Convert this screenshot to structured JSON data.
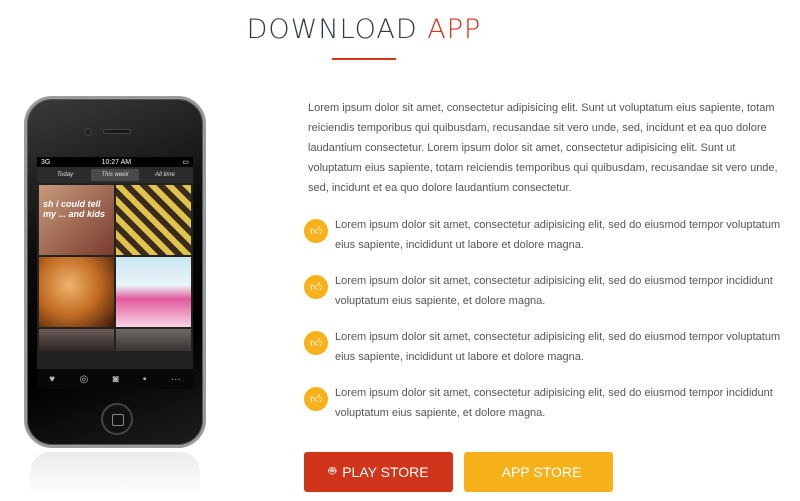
{
  "heading": {
    "word1": "DOWNLOAD",
    "word2": "APP"
  },
  "colors": {
    "accent_red": "#d0341a",
    "accent_yellow": "#f7b21b",
    "heading_dark": "#2f3a45"
  },
  "phone": {
    "status_carrier": "3G",
    "status_time": "10:27 AM",
    "tabs": [
      "Today",
      "This week",
      "All time"
    ],
    "thumb_text": "sh i could tell my ... and kids"
  },
  "intro": "Lorem ipsum dolor sit amet, consectetur adipisicing elit. Sunt ut voluptatum eius sapiente, totam reiciendis temporibus qui quibusdam, recusandae sit vero unde, sed, incidunt et ea quo dolore laudantium consectetur. Lorem ipsum dolor sit amet, consectetur adipisicing elit. Sunt ut voluptatum eius sapiente, totam reiciendis temporibus qui quibusdam, recusandae sit vero unde, sed, incidunt et ea quo dolore laudantium consectetur.",
  "features": [
    {
      "icon": "thumbs-up-icon",
      "text": "Lorem ipsum dolor sit amet, consectetur adipisicing elit, sed do eiusmod tempor voluptatum eius sapiente, incididunt ut labore et dolore magna."
    },
    {
      "icon": "thumbs-up-icon",
      "text": "Lorem ipsum dolor sit amet, consectetur adipisicing elit, sed do eiusmod tempor incididunt voluptatum eius sapiente, et dolore magna."
    },
    {
      "icon": "thumbs-up-icon",
      "text": "Lorem ipsum dolor sit amet, consectetur adipisicing elit, sed do eiusmod tempor voluptatum eius sapiente, incididunt ut labore et dolore magna."
    },
    {
      "icon": "thumbs-up-icon",
      "text": "Lorem ipsum dolor sit amet, consectetur adipisicing elit, sed do eiusmod tempor incididunt voluptatum eius sapiente, et dolore magna."
    }
  ],
  "buttons": {
    "play_store": {
      "label": "PLAY STORE",
      "icon": "android-icon"
    },
    "app_store": {
      "label": "APP STORE",
      "icon": "apple-icon"
    }
  }
}
